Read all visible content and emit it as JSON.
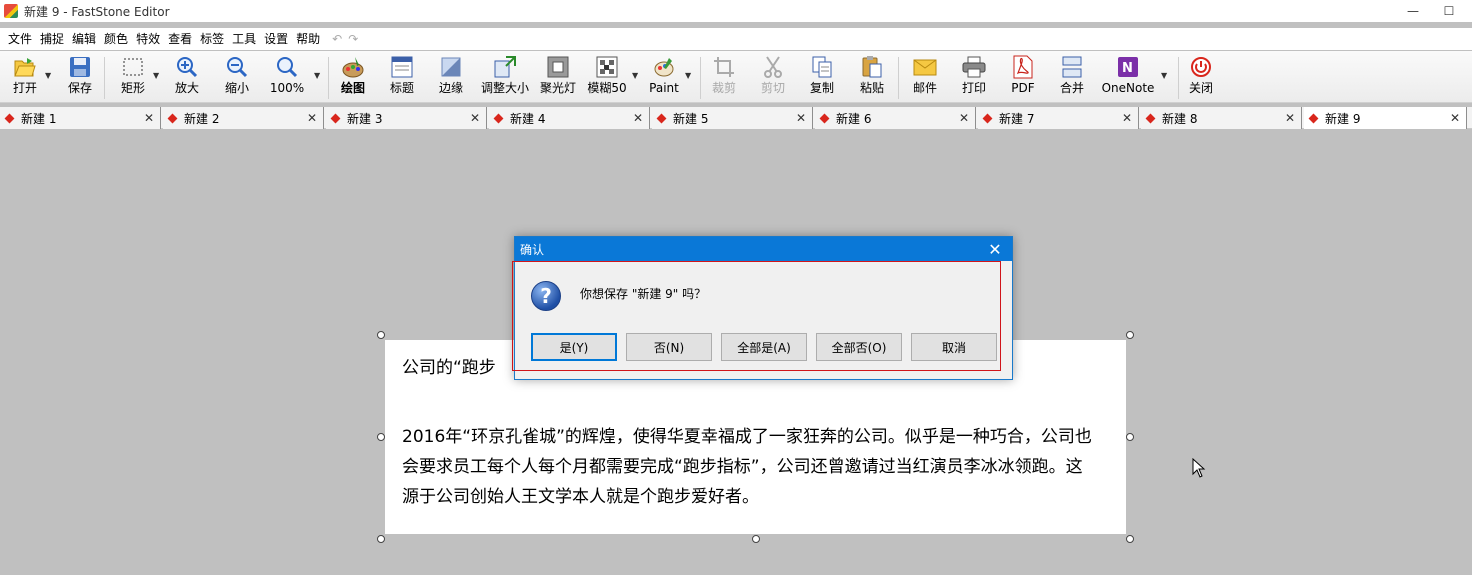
{
  "window": {
    "title": "新建 9 - FastStone Editor",
    "min_glyph": "—",
    "max_glyph": "☐"
  },
  "menu": [
    "文件",
    "捕捉",
    "编辑",
    "颜色",
    "特效",
    "查看",
    "标签",
    "工具",
    "设置",
    "帮助"
  ],
  "undo_redo": "↶↷",
  "toolbar": {
    "open": "打开",
    "save": "保存",
    "rect": "矩形",
    "zoom_in": "放大",
    "zoom_out": "缩小",
    "zoom_level": "100%",
    "draw": "绘图",
    "caption": "标题",
    "edge": "边缘",
    "resize": "调整大小",
    "spotlight": "聚光灯",
    "blur": "模糊50",
    "paint": "Paint",
    "crop": "裁剪",
    "cut": "剪切",
    "copy": "复制",
    "paste": "粘贴",
    "email": "邮件",
    "print": "打印",
    "pdf": "PDF",
    "merge": "合并",
    "onenote": "OneNote",
    "close": "关闭"
  },
  "tabs": [
    "新建 1",
    "新建 2",
    "新建 3",
    "新建 4",
    "新建 5",
    "新建 6",
    "新建 7",
    "新建 8",
    "新建 9"
  ],
  "active_tab": "新建 9",
  "document": {
    "line1": "公司的“跑步",
    "paragraph": "2016年“环京孔雀城”的辉煌，使得华夏幸福成了一家狂奔的公司。似乎是一种巧合，公司也会要求员工每个人每个月都需要完成“跑步指标”，公司还曾邀请过当红演员李冰冰领跑。这源于公司创始人王文学本人就是个跑步爱好者。"
  },
  "dialog": {
    "title": "确认",
    "message": "你想保存 \"新建 9\" 吗？",
    "buttons": [
      "是(Y)",
      "否(N)",
      "全部是(A)",
      "全部否(O)",
      "取消"
    ]
  },
  "colors": {
    "titlebar_blue": "#0a78d7",
    "tab_marker": "#d9261c",
    "focus_border": "#d0141a"
  }
}
